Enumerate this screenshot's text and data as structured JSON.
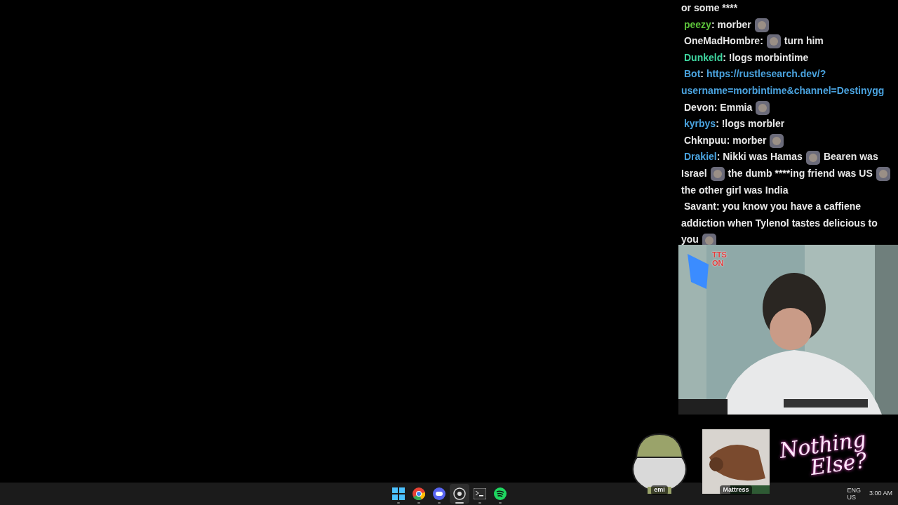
{
  "chat": {
    "messages": [
      {
        "parts": [
          {
            "kind": "text",
            "text": "or some ****"
          }
        ]
      },
      {
        "user": "peezy",
        "color": "#5cc23a",
        "parts": [
          {
            "kind": "text",
            "text": ": morber"
          },
          {
            "kind": "emote"
          }
        ]
      },
      {
        "user": "OneMadHombre",
        "color": "#e8e8e8",
        "parts": [
          {
            "kind": "text",
            "text": ":"
          },
          {
            "kind": "emote"
          },
          {
            "kind": "text",
            "text": "turn him"
          }
        ]
      },
      {
        "user": "Dunkeld",
        "color": "#3fd6a0",
        "parts": [
          {
            "kind": "text",
            "text": ": !logs morbintime"
          }
        ]
      },
      {
        "user": "Bot",
        "color": "#4aa3df",
        "parts": [
          {
            "kind": "text",
            "text": ":"
          },
          {
            "kind": "link",
            "text": "https://rustlesearch.dev/?username=morbintime&channel=Destinygg"
          }
        ]
      },
      {
        "user": "Devon",
        "color": "#e8e8e8",
        "parts": [
          {
            "kind": "text",
            "text": ": Emmia"
          },
          {
            "kind": "emote"
          }
        ]
      },
      {
        "user": "kyrbys",
        "color": "#4aa3df",
        "parts": [
          {
            "kind": "text",
            "text": ": !logs morbler"
          }
        ]
      },
      {
        "user": "Chknpuu",
        "color": "#e8e8e8",
        "parts": [
          {
            "kind": "text",
            "text": ": morber"
          },
          {
            "kind": "emote"
          }
        ]
      },
      {
        "user": "Drakiel",
        "color": "#4aa3df",
        "parts": [
          {
            "kind": "text",
            "text": ": Nikki was Hamas"
          },
          {
            "kind": "emote"
          },
          {
            "kind": "text",
            "text": "Bearen was Israel"
          },
          {
            "kind": "emote"
          },
          {
            "kind": "text",
            "text": "the dumb ****ing friend was US"
          },
          {
            "kind": "emote"
          },
          {
            "kind": "text",
            "text": "the other girl was India"
          }
        ]
      },
      {
        "user": "Savant",
        "color": "#e8e8e8",
        "parts": [
          {
            "kind": "text",
            "text": ": you know you have a caffiene addiction when Tylenol tastes delicious to you"
          },
          {
            "kind": "emote"
          }
        ]
      }
    ]
  },
  "webcam": {
    "kind": "picture",
    "badge": "TTS ON"
  },
  "overlays": [
    {
      "kind": "avatar",
      "label": "emi"
    },
    {
      "kind": "picture",
      "label": "Mattress"
    }
  ],
  "neon_sign": {
    "line_1": "Nothing",
    "line_2": "Else?"
  },
  "taskbar": {
    "apps": [
      {
        "kind": "start",
        "selected": false
      },
      {
        "kind": "browser",
        "selected": false
      },
      {
        "kind": "chat",
        "selected": false
      },
      {
        "kind": "recorder",
        "selected": true
      },
      {
        "kind": "terminal",
        "selected": false
      },
      {
        "kind": "music",
        "selected": false
      }
    ],
    "language": "ENG",
    "region": "US",
    "time": "3:00 AM"
  }
}
